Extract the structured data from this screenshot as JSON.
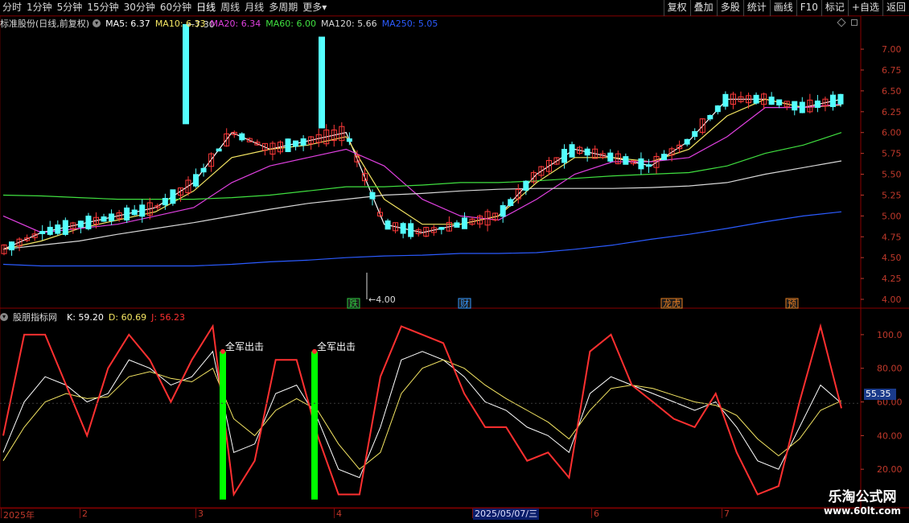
{
  "toolbar": {
    "periods": [
      "分时",
      "1分钟",
      "5分钟",
      "15分钟",
      "30分钟",
      "60分钟",
      "日线",
      "周线",
      "月线",
      "多周期",
      "更多"
    ],
    "active_period": "日线",
    "more_arrow": "▾",
    "buttons": [
      "复权",
      "叠加",
      "多股",
      "统计",
      "画线",
      "F10",
      "标记",
      "+自选",
      "返回"
    ]
  },
  "main_info": {
    "title": "标准股份(日线,前复权)",
    "ma": [
      {
        "label": "MA5: 6.37",
        "color": "#ffffff"
      },
      {
        "label": "MA10: 6.33",
        "color": "#f5e663"
      },
      {
        "label": "MA20: 6.34",
        "color": "#e040e0"
      },
      {
        "label": "MA60: 6.00",
        "color": "#40e040"
      },
      {
        "label": "MA120: 5.66",
        "color": "#d8d8d8"
      },
      {
        "label": "MA250: 5.05",
        "color": "#2b5bff"
      }
    ]
  },
  "indicator_info": {
    "title": "股朋指标网",
    "values": [
      {
        "label": "K: 59.20",
        "color": "#ffffff"
      },
      {
        "label": "D: 60.69",
        "color": "#f5e663"
      },
      {
        "label": "J: 56.23",
        "color": "#ff3030"
      }
    ],
    "current_value": "55.35"
  },
  "price_axis": [
    "7.00",
    "6.75",
    "6.50",
    "6.25",
    "6.00",
    "5.75",
    "5.50",
    "5.25",
    "5.00",
    "4.75",
    "4.50",
    "4.25",
    "4.00"
  ],
  "indicator_axis": [
    "100.0",
    "80.00",
    "60.00",
    "40.00",
    "20.00"
  ],
  "annotations": {
    "high_label": "7.30",
    "low_label": "4.00",
    "signal_text": "全军出击",
    "event_tags": [
      {
        "text": "跌",
        "color": "#2ecc40"
      },
      {
        "text": "财",
        "color": "#3498ff"
      },
      {
        "text": "龙虎",
        "color": "#e67e22"
      },
      {
        "text": "预",
        "color": "#e67e22"
      }
    ]
  },
  "date_axis": {
    "labels": [
      "2025年",
      "2",
      "3",
      "4",
      "5",
      "6",
      "7"
    ],
    "highlight": "2025/05/07/三"
  },
  "watermark": {
    "line1": "乐淘公式网",
    "line2": "www.60lt.com"
  },
  "colors": {
    "up": "#ff3a3a",
    "down": "#54ffff",
    "grid": "#5a0000",
    "signal_bar": "#00ff00"
  },
  "chart_data": [
    {
      "type": "line",
      "title": "标准股份(日线,前复权)",
      "xlabel": "",
      "ylabel": "",
      "ylim": [
        4.0,
        7.3
      ],
      "x_ticks": [
        "2025年",
        "2",
        "3",
        "4",
        "5",
        "6",
        "7"
      ],
      "series": [
        {
          "name": "MA5",
          "values": [
            4.6,
            4.8,
            4.9,
            5.0,
            5.1,
            5.4,
            6.0,
            5.8,
            5.9,
            6.0,
            4.9,
            4.8,
            4.9,
            5.0,
            5.5,
            5.8,
            5.7,
            5.6,
            5.9,
            6.4,
            6.4,
            6.3,
            6.4
          ]
        },
        {
          "name": "MA10",
          "values": [
            4.6,
            4.7,
            4.85,
            4.95,
            5.05,
            5.3,
            5.7,
            5.8,
            5.85,
            5.95,
            5.2,
            4.9,
            4.9,
            5.0,
            5.4,
            5.7,
            5.7,
            5.65,
            5.8,
            6.2,
            6.4,
            6.3,
            6.33
          ]
        },
        {
          "name": "MA20",
          "values": [
            5.0,
            4.8,
            4.85,
            4.9,
            5.0,
            5.1,
            5.4,
            5.6,
            5.7,
            5.8,
            5.6,
            5.2,
            5.0,
            4.95,
            5.2,
            5.5,
            5.65,
            5.65,
            5.7,
            5.95,
            6.3,
            6.3,
            6.34
          ]
        },
        {
          "name": "MA60",
          "values": [
            5.25,
            5.24,
            5.22,
            5.2,
            5.2,
            5.2,
            5.22,
            5.25,
            5.3,
            5.35,
            5.35,
            5.37,
            5.4,
            5.4,
            5.42,
            5.45,
            5.48,
            5.5,
            5.52,
            5.6,
            5.75,
            5.85,
            6.0
          ]
        },
        {
          "name": "MA120",
          "values": [
            4.6,
            4.65,
            4.7,
            4.78,
            4.85,
            4.92,
            5.0,
            5.08,
            5.15,
            5.2,
            5.25,
            5.27,
            5.3,
            5.32,
            5.33,
            5.33,
            5.33,
            5.34,
            5.36,
            5.4,
            5.5,
            5.58,
            5.66
          ]
        },
        {
          "name": "MA250",
          "values": [
            4.42,
            4.4,
            4.4,
            4.4,
            4.4,
            4.4,
            4.42,
            4.45,
            4.47,
            4.5,
            4.52,
            4.53,
            4.55,
            4.55,
            4.56,
            4.6,
            4.65,
            4.72,
            4.78,
            4.85,
            4.93,
            5.0,
            5.05
          ]
        }
      ]
    },
    {
      "type": "line",
      "title": "股朋指标网",
      "xlabel": "",
      "ylabel": "",
      "ylim": [
        0,
        110
      ],
      "series": [
        {
          "name": "K",
          "values": [
            30,
            60,
            75,
            70,
            60,
            65,
            85,
            80,
            70,
            75,
            90,
            30,
            35,
            65,
            70,
            50,
            20,
            15,
            45,
            85,
            90,
            85,
            75,
            60,
            55,
            45,
            40,
            30,
            65,
            75,
            70,
            65,
            60,
            55,
            60,
            45,
            25,
            20,
            45,
            70,
            59.2
          ]
        },
        {
          "name": "D",
          "values": [
            25,
            45,
            60,
            65,
            62,
            63,
            75,
            78,
            74,
            72,
            80,
            50,
            40,
            55,
            62,
            55,
            35,
            20,
            30,
            65,
            80,
            85,
            80,
            70,
            62,
            55,
            48,
            38,
            55,
            68,
            70,
            68,
            64,
            60,
            58,
            52,
            38,
            28,
            38,
            55,
            60.69
          ]
        },
        {
          "name": "J",
          "values": [
            40,
            100,
            100,
            70,
            40,
            80,
            100,
            85,
            60,
            85,
            105,
            5,
            25,
            85,
            85,
            40,
            5,
            5,
            75,
            105,
            100,
            95,
            65,
            45,
            45,
            25,
            30,
            15,
            90,
            100,
            70,
            60,
            50,
            45,
            65,
            30,
            5,
            10,
            60,
            105,
            56.23
          ]
        }
      ]
    }
  ]
}
